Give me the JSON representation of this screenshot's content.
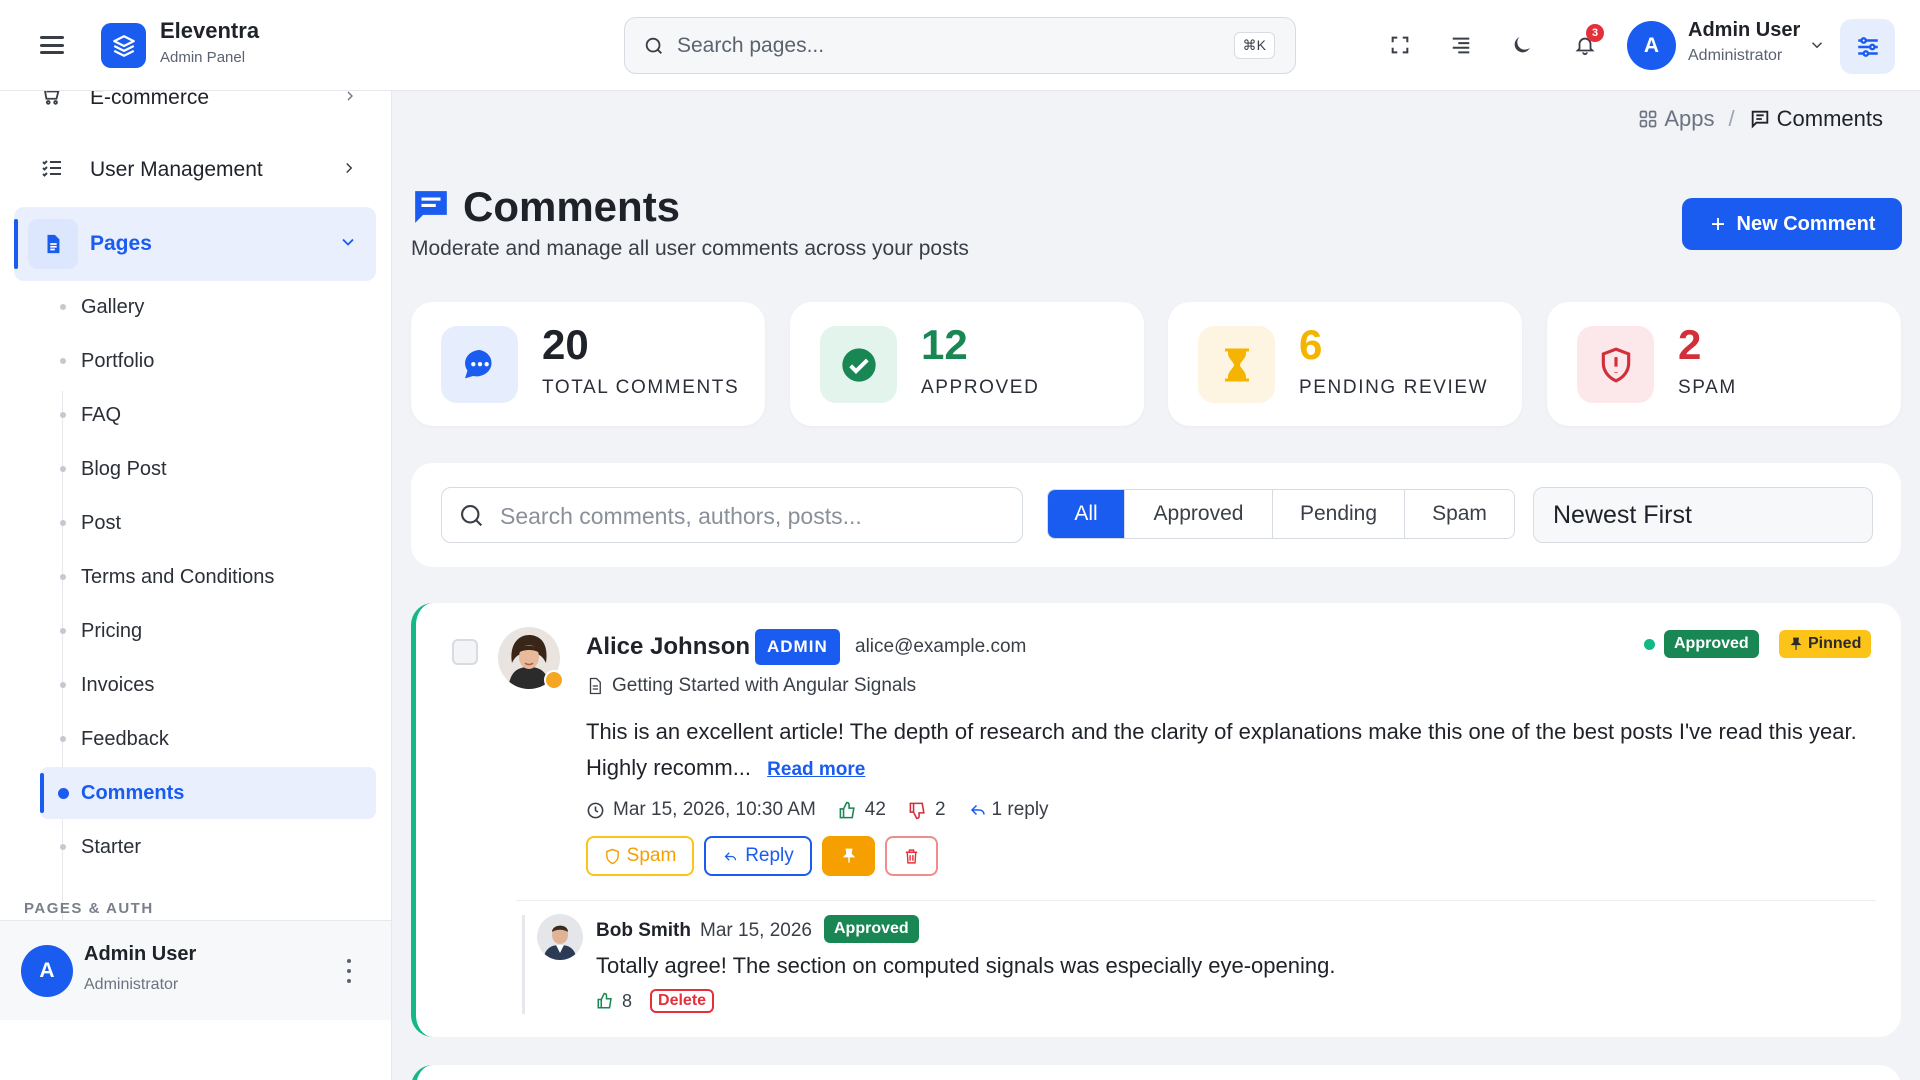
{
  "topbar": {
    "brand_name": "Eleventra",
    "brand_sub": "Admin Panel",
    "search_placeholder": "Search pages...",
    "search_shortcut": "⌘K",
    "notification_count": "3",
    "user_initial": "A",
    "user_name": "Admin User",
    "user_role": "Administrator"
  },
  "sidebar": {
    "top_partial_label": "E-commerce",
    "user_management": "User Management",
    "pages": "Pages",
    "sub_items": [
      "Gallery",
      "Portfolio",
      "FAQ",
      "Blog Post",
      "Post",
      "Terms and Conditions",
      "Pricing",
      "Invoices",
      "Feedback",
      "Comments",
      "Starter"
    ],
    "active_sub_item": "Comments",
    "section_label": "PAGES & AUTH",
    "footer": {
      "initial": "A",
      "name": "Admin User",
      "role": "Administrator"
    }
  },
  "breadcrumb": {
    "parent": "Apps",
    "separator": "/",
    "current": "Comments"
  },
  "header": {
    "title": "Comments",
    "subtitle": "Moderate and manage all user comments across your posts",
    "new_button": "New Comment"
  },
  "stats": [
    {
      "value": "20",
      "label": "TOTAL COMMENTS",
      "icon": "chat-bubble-icon",
      "color": "#1a5cf0",
      "bg": "#e6edfc"
    },
    {
      "value": "12",
      "label": "APPROVED",
      "icon": "check-circle-icon",
      "color": "#198754",
      "bg": "#e3f4ec"
    },
    {
      "value": "6",
      "label": "PENDING REVIEW",
      "icon": "hourglass-icon",
      "color": "#f5b400",
      "bg": "#fdf4e1"
    },
    {
      "value": "2",
      "label": "SPAM",
      "icon": "shield-alert-icon",
      "color": "#d32f3a",
      "bg": "#fce8ea"
    }
  ],
  "filters": {
    "search_placeholder": "Search comments, authors, posts...",
    "tabs": [
      "All",
      "Approved",
      "Pending",
      "Spam"
    ],
    "active_tab": "All",
    "sort": "Newest First"
  },
  "comment": {
    "author": "Alice Johnson",
    "role_badge": "ADMIN",
    "email": "alice@example.com",
    "post_title": "Getting Started with Angular Signals",
    "status": "Approved",
    "pinned_label": "Pinned",
    "body": "This is an excellent article! The depth of research and the clarity of explanations make this one of the best posts I've read this year. Highly recomm...",
    "read_more": "Read more",
    "date": "Mar 15, 2026, 10:30 AM",
    "likes": "42",
    "dislikes": "2",
    "replies": "1 reply",
    "actions": {
      "spam": "Spam",
      "reply": "Reply"
    },
    "reply": {
      "author": "Bob Smith",
      "date": "Mar 15, 2026",
      "status": "Approved",
      "body": "Totally agree! The section on computed signals was especially eye-opening.",
      "likes": "8",
      "delete": "Delete"
    }
  }
}
